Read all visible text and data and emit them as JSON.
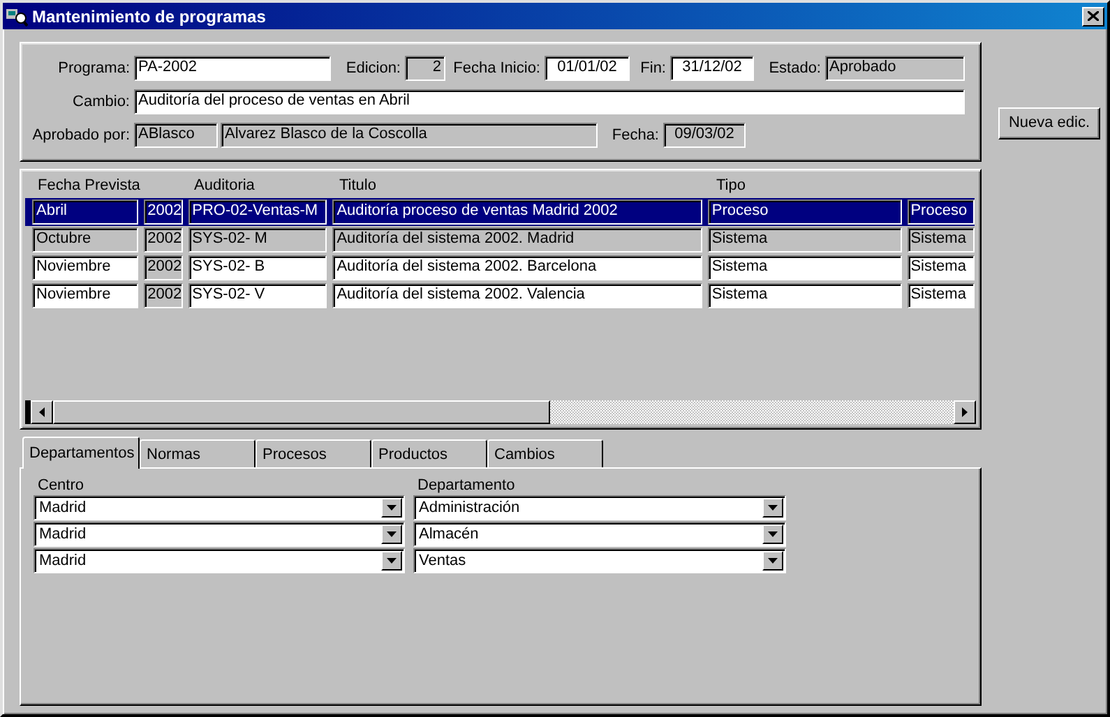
{
  "window": {
    "title": "Mantenimiento de programas"
  },
  "form": {
    "fields": [
      {
        "label": "Programa:",
        "value": "PA-2002",
        "readonly": false
      },
      {
        "label": "Edicion:",
        "value": "2",
        "readonly": true
      },
      {
        "label": "Fecha Inicio:",
        "value": "01/01/02",
        "readonly": false
      },
      {
        "label": "Fin:",
        "value": "31/12/02",
        "readonly": false
      },
      {
        "label": "Estado:",
        "value": "Aprobado",
        "readonly": true
      },
      {
        "label": "Cambio:",
        "value": "Auditoría del proceso de ventas en Abril",
        "readonly": false
      },
      {
        "label": "Aprobado por:",
        "value": "ABlasco",
        "readonly": true
      },
      {
        "value": "Alvarez Blasco de la Coscolla",
        "readonly": true
      },
      {
        "label": "Fecha:",
        "value": "09/03/02",
        "readonly": true
      }
    ]
  },
  "side_button": "Nueva edic.",
  "table": {
    "columns": [
      "Fecha Prevista",
      "",
      "Auditoria",
      "Titulo",
      "Tipo"
    ],
    "rows": [
      {
        "selected": true,
        "readonly": false,
        "cells": [
          "Abril",
          "2002",
          "PRO-02-Ventas-M",
          "Auditoría proceso de ventas Madrid 2002",
          "Proceso",
          "Proceso"
        ]
      },
      {
        "selected": false,
        "readonly": true,
        "cells": [
          "Octubre",
          "2002",
          "SYS-02- M",
          "Auditoría del sistema 2002. Madrid",
          "Sistema",
          "Sistema"
        ]
      },
      {
        "selected": false,
        "readonly": false,
        "cells": [
          "Noviembre",
          "2002",
          "SYS-02- B",
          "Auditoría del sistema 2002. Barcelona",
          "Sistema",
          "Sistema"
        ]
      },
      {
        "selected": false,
        "readonly": false,
        "cells": [
          "Noviembre",
          "2002",
          "SYS-02- V",
          "Auditoría del sistema 2002. Valencia",
          "Sistema",
          "Sistema"
        ]
      }
    ]
  },
  "tabs": [
    {
      "label": "Departamentos",
      "selected": true
    },
    {
      "label": "Normas",
      "selected": false
    },
    {
      "label": "Procesos",
      "selected": false
    },
    {
      "label": "Productos",
      "selected": false
    },
    {
      "label": "Cambios",
      "selected": false
    }
  ],
  "departments": {
    "columns": [
      "Centro",
      "Departamento"
    ],
    "rows": [
      [
        "Madrid",
        "Administración"
      ],
      [
        "Madrid",
        "Almacén"
      ],
      [
        "Madrid",
        "Ventas"
      ]
    ]
  }
}
